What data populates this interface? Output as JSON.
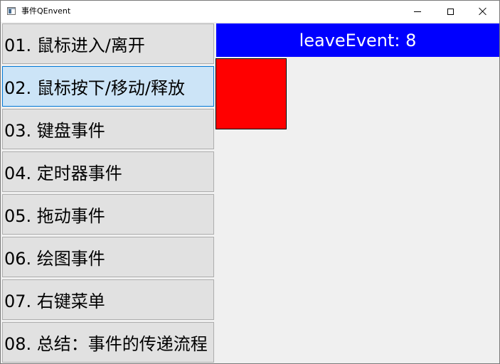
{
  "window": {
    "title": "事件QEnvent",
    "controls": [
      "minimize",
      "maximize",
      "close"
    ]
  },
  "nav": {
    "items": [
      {
        "label": "01. 鼠标进入/离开"
      },
      {
        "label": "02. 鼠标按下/移动/释放",
        "selected": true
      },
      {
        "label": "03. 键盘事件"
      },
      {
        "label": "04. 定时器事件"
      },
      {
        "label": "05. 拖动事件"
      },
      {
        "label": "06. 绘图事件"
      },
      {
        "label": "07. 右键菜单"
      },
      {
        "label": "08. 总结：事件的传递流程"
      }
    ]
  },
  "main": {
    "status_text": "leaveEvent: 8",
    "status_bg": "#0000ff",
    "status_fg": "#ffffff",
    "square_color": "#ff0000"
  }
}
